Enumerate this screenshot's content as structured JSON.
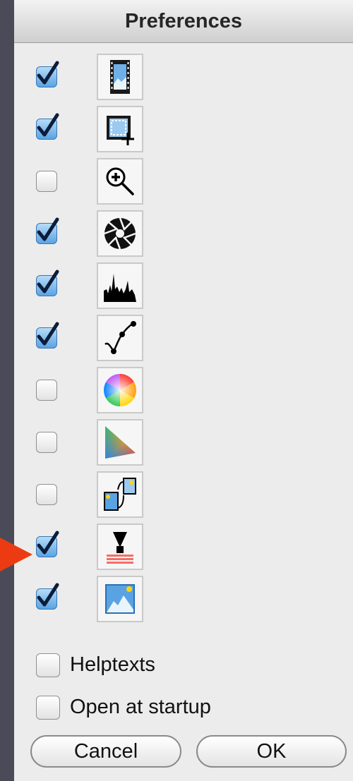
{
  "dialog": {
    "title": "Preferences"
  },
  "tools": [
    {
      "icon": "filmstrip-icon",
      "checked": true
    },
    {
      "icon": "crop-selection-icon",
      "checked": true
    },
    {
      "icon": "zoom-icon",
      "checked": false
    },
    {
      "icon": "aperture-icon",
      "checked": true
    },
    {
      "icon": "histogram-icon",
      "checked": true
    },
    {
      "icon": "curves-icon",
      "checked": true
    },
    {
      "icon": "color-wheel-icon",
      "checked": false
    },
    {
      "icon": "gamut-triangle-icon",
      "checked": false
    },
    {
      "icon": "compare-images-icon",
      "checked": false
    },
    {
      "icon": "levels-icon",
      "checked": true
    },
    {
      "icon": "picture-icon",
      "checked": true
    }
  ],
  "options": {
    "helptexts": {
      "label": "Helptexts",
      "checked": false
    },
    "open_at_startup": {
      "label": "Open at startup",
      "checked": false
    }
  },
  "buttons": {
    "cancel": "Cancel",
    "ok": "OK"
  },
  "colors": {
    "check_blue": "#5aa3e3",
    "pointer_arrow": "#ec3b12"
  }
}
